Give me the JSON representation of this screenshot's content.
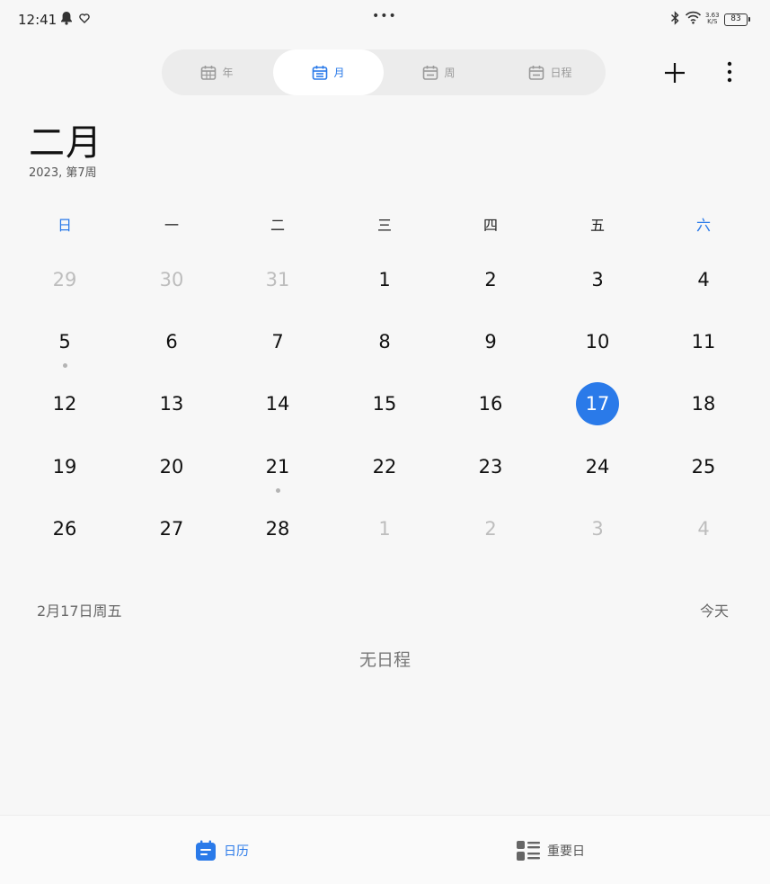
{
  "status_bar": {
    "time": "12:41",
    "dots": "•••",
    "net_speed_value": "3.63",
    "net_speed_unit": "K/S",
    "battery": "83"
  },
  "view_switcher": {
    "items": [
      {
        "label": "年",
        "icon": "calendar-grid-icon",
        "active": false
      },
      {
        "label": "月",
        "icon": "calendar-month-icon",
        "active": true
      },
      {
        "label": "周",
        "icon": "calendar-week-icon",
        "active": false
      },
      {
        "label": "日程",
        "icon": "calendar-agenda-icon",
        "active": false
      }
    ]
  },
  "header": {
    "month": "二月",
    "subtitle": "2023, 第7周"
  },
  "weekdays": [
    "日",
    "一",
    "二",
    "三",
    "四",
    "五",
    "六"
  ],
  "weeks": [
    [
      {
        "d": "29",
        "muted": true
      },
      {
        "d": "30",
        "muted": true
      },
      {
        "d": "31",
        "muted": true
      },
      {
        "d": "1"
      },
      {
        "d": "2"
      },
      {
        "d": "3"
      },
      {
        "d": "4"
      }
    ],
    [
      {
        "d": "5",
        "event": true
      },
      {
        "d": "6"
      },
      {
        "d": "7"
      },
      {
        "d": "8"
      },
      {
        "d": "9"
      },
      {
        "d": "10"
      },
      {
        "d": "11"
      }
    ],
    [
      {
        "d": "12"
      },
      {
        "d": "13"
      },
      {
        "d": "14"
      },
      {
        "d": "15"
      },
      {
        "d": "16"
      },
      {
        "d": "17",
        "today": true
      },
      {
        "d": "18"
      }
    ],
    [
      {
        "d": "19"
      },
      {
        "d": "20"
      },
      {
        "d": "21",
        "event": true
      },
      {
        "d": "22"
      },
      {
        "d": "23"
      },
      {
        "d": "24"
      },
      {
        "d": "25"
      }
    ],
    [
      {
        "d": "26"
      },
      {
        "d": "27"
      },
      {
        "d": "28"
      },
      {
        "d": "1",
        "muted": true
      },
      {
        "d": "2",
        "muted": true
      },
      {
        "d": "3",
        "muted": true
      },
      {
        "d": "4",
        "muted": true
      }
    ]
  ],
  "selected": {
    "date_label": "2月17日周五",
    "today_label": "今天",
    "empty_label": "无日程"
  },
  "bottom_nav": {
    "calendar_label": "日历",
    "important_label": "重要日"
  },
  "colors": {
    "accent": "#2a7ae9",
    "muted_text": "#bdbdbd",
    "background": "#f7f7f7"
  }
}
